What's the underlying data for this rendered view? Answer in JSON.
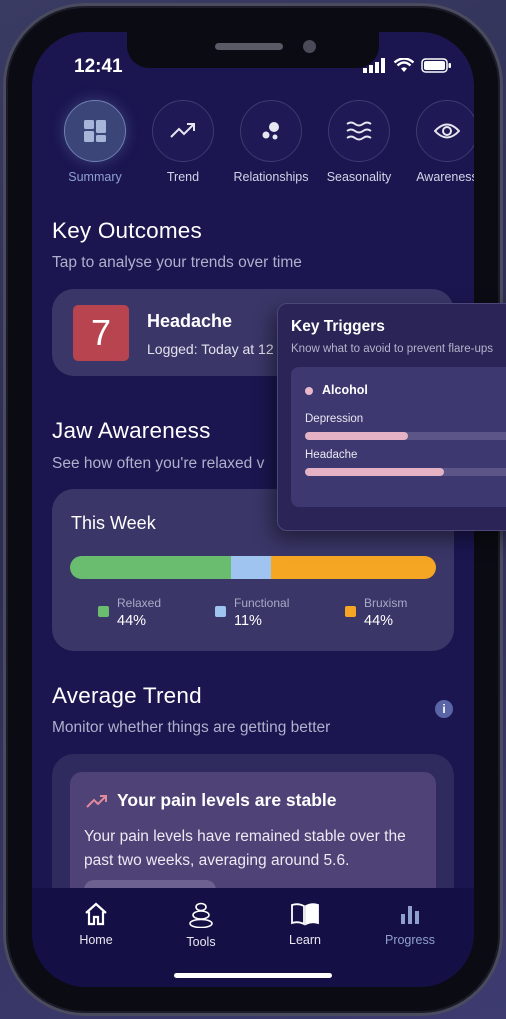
{
  "status": {
    "time": "12:41"
  },
  "tabs": [
    {
      "label": "Summary",
      "icon": "grid-icon"
    },
    {
      "label": "Trend",
      "icon": "trend-up-icon"
    },
    {
      "label": "Relationships",
      "icon": "bubbles-icon"
    },
    {
      "label": "Seasonality",
      "icon": "waves-icon"
    },
    {
      "label": "Awareness",
      "icon": "eye-icon"
    }
  ],
  "key_outcomes": {
    "title": "Key Outcomes",
    "subtitle": "Tap to analyse your trends over time",
    "card": {
      "value": "7",
      "name": "Headache",
      "logged": "Logged: Today at 12"
    }
  },
  "jaw_awareness": {
    "title": "Jaw Awareness",
    "subtitle": "See how often you're relaxed v",
    "week_title": "This Week",
    "segments": [
      {
        "label": "Relaxed",
        "value": "44%",
        "fraction": 0.44,
        "color": "#6abd6e"
      },
      {
        "label": "Functional",
        "value": "11%",
        "fraction": 0.11,
        "color": "#9fc4f0"
      },
      {
        "label": "Bruxism",
        "value": "44%",
        "fraction": 0.45,
        "color": "#f5a623"
      }
    ]
  },
  "average_trend": {
    "title": "Average Trend",
    "subtitle": "Monitor whether things are getting better",
    "info_glyph": "i",
    "card_title": "Your pain levels are stable",
    "card_body": "Your pain levels have remained stable over the past two weeks, averaging around 5.6."
  },
  "nav": [
    {
      "label": "Home",
      "icon": "home-icon"
    },
    {
      "label": "Tools",
      "icon": "stones-icon"
    },
    {
      "label": "Learn",
      "icon": "book-icon"
    },
    {
      "label": "Progress",
      "icon": "bar-chart-icon"
    }
  ],
  "key_triggers": {
    "title": "Key Triggers",
    "subtitle": "Know what to avoid to prevent flare-ups",
    "trigger": "Alcohol",
    "rows": [
      {
        "label": "Depression",
        "fraction": 0.43
      },
      {
        "label": "Headache",
        "fraction": 0.58
      }
    ]
  }
}
